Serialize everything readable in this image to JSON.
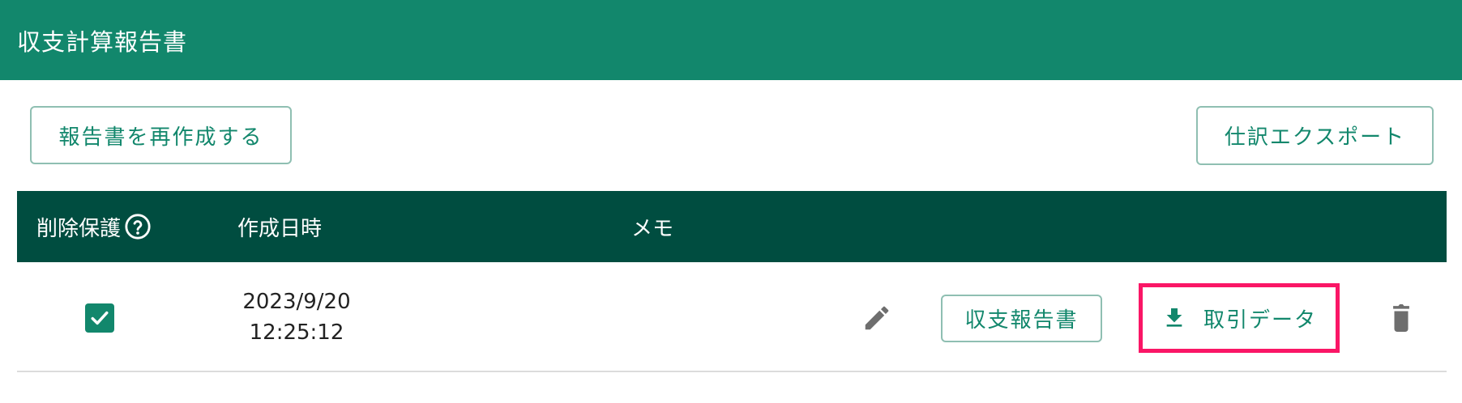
{
  "header": {
    "title": "収支計算報告書"
  },
  "toolbar": {
    "regenerate_label": "報告書を再作成する",
    "export_label": "仕訳エクスポート"
  },
  "table": {
    "columns": {
      "protect": "削除保護",
      "created": "作成日時",
      "memo": "メモ"
    },
    "rows": [
      {
        "protected": true,
        "date": "2023/9/20",
        "time": "12:25:12",
        "memo": "",
        "report_label": "収支報告書",
        "download_label": "取引データ"
      }
    ]
  },
  "colors": {
    "header": "#12876c",
    "table_header": "#004d40",
    "accent": "#12876c",
    "highlight_border": "#fa1666",
    "icon_gray": "#6e6e6e"
  },
  "icons": [
    "question-circle-icon",
    "checkmark-icon",
    "pencil-icon",
    "download-icon",
    "trash-icon"
  ]
}
